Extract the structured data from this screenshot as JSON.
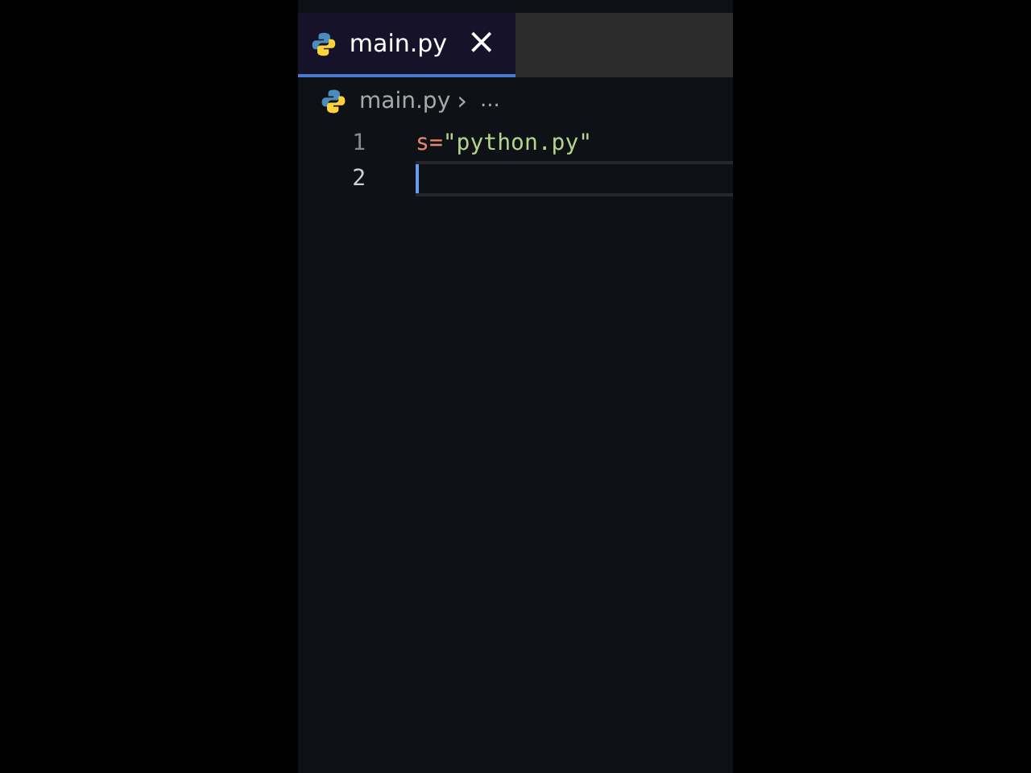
{
  "tabs": [
    {
      "label": "main.py",
      "selected": true,
      "close": "×"
    }
  ],
  "breadcrumb": {
    "file": "main.py",
    "separator": "›",
    "rest": "..."
  },
  "lines": [
    {
      "number": "1",
      "current": false,
      "tokens": [
        {
          "kind": "variable",
          "text": "s"
        },
        {
          "kind": "operator",
          "text": "="
        },
        {
          "kind": "string",
          "text": "\"python.py\""
        }
      ]
    },
    {
      "number": "2",
      "current": true
    }
  ]
}
